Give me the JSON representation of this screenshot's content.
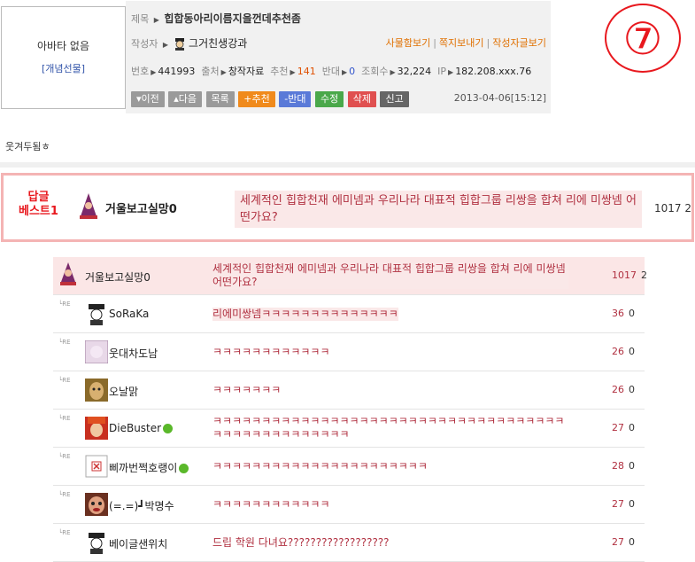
{
  "avatar": {
    "none_text": "아바타 없음",
    "gift_link": "[개념선물]"
  },
  "post": {
    "title_label": "제목",
    "title": "힙합동아리이름지을껀데추천좀",
    "author_label": "작성자",
    "author": "그거친생강과",
    "links": [
      "사물함보기",
      "쪽지보내기",
      "작성자글보기"
    ],
    "meta": {
      "number_label": "번호",
      "number": "441993",
      "source_label": "출처",
      "source": "창작자료",
      "recommend_label": "추천",
      "recommend": "141",
      "oppose_label": "반대",
      "oppose": "0",
      "views_label": "조회수",
      "views": "32,224",
      "ip_label": "IP",
      "ip": "182.208.xxx.76"
    },
    "buttons": {
      "prev": "▾이전",
      "next": "▴다음",
      "list": "목록",
      "recommend": "+추천",
      "oppose": "-반대",
      "edit": "수정",
      "delete": "삭제",
      "report": "신고"
    },
    "date": "2013-04-06[15:12]",
    "body": "웃겨두됨ㅎ"
  },
  "marker": "⑦",
  "best_reply": {
    "badge_line1": "답글",
    "badge_line2": "베스트1",
    "author": "거울보고실망0",
    "text": "세계적인 힙합천재 에미넴과 우리나라 대표적 힙합그룹 리쌍을 합쳐 리에 미쌍넴 어떤가요?",
    "count": "1017 2"
  },
  "replies": [
    {
      "author": "거울보고실망0",
      "text": "세계적인 힙합천재 에미넴과 우리나라 대표적 힙합그룹 리쌍을 합쳐 리에 미쌍넴 어떤가요?",
      "count": "1017",
      "zero": "2"
    },
    {
      "re": "└RE",
      "author": "SoRaKa",
      "text": "리에미쌍넴ㅋㅋㅋㅋㅋㅋㅋㅋㅋㅋㅋㅋㅋㅋ",
      "count": "36",
      "zero": "0"
    },
    {
      "re": "└RE",
      "author": "웃대차도남",
      "text": "ㅋㅋㅋㅋㅋㅋㅋㅋㅋㅋㅋㅋ",
      "count": "26",
      "zero": "0"
    },
    {
      "re": "└RE",
      "author": "오날맑",
      "text": "ㅋㅋㅋㅋㅋㅋㅋ",
      "count": "26",
      "zero": "0"
    },
    {
      "re": "└RE",
      "author": "DieBuster",
      "text": "ㅋㅋㅋㅋㅋㅋㅋㅋㅋㅋㅋㅋㅋㅋㅋㅋㅋㅋㅋㅋㅋㅋㅋㅋㅋㅋㅋㅋㅋㅋㅋㅋㅋㅋㅋㅋㅋㅋㅋㅋㅋㅋㅋㅋㅋㅋㅋㅋㅋㅋ",
      "count": "27",
      "zero": "0"
    },
    {
      "re": "└RE",
      "author": "삐까번쩍호랭이",
      "text": "ㅋㅋㅋㅋㅋㅋㅋㅋㅋㅋㅋㅋㅋㅋㅋㅋㅋㅋㅋㅋㅋㅋ",
      "count": "28",
      "zero": "0"
    },
    {
      "re": "└RE",
      "author": "(=.=)┛박명수",
      "text": "ㅋㅋㅋㅋㅋㅋㅋㅋㅋㅋㅋㅋ",
      "count": "27",
      "zero": "0"
    },
    {
      "re": "└RE",
      "author": "베이글샌위치",
      "text": "드립 학원 다녀요??????????????????",
      "count": "27",
      "zero": "0"
    }
  ],
  "colors": {
    "accent_red": "#e8181e",
    "reply_text": "#b03040",
    "highlight_bg": "#fae8e8"
  }
}
